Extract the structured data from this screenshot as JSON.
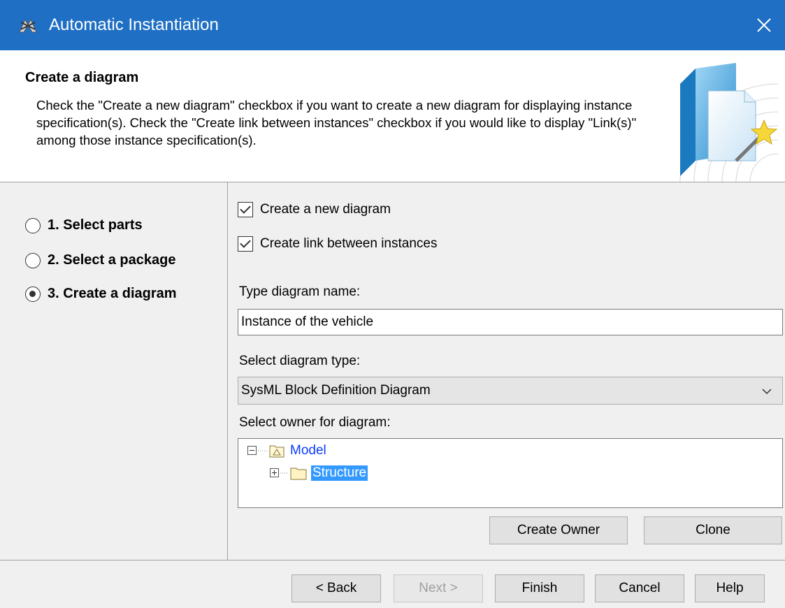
{
  "window": {
    "title": "Automatic Instantiation",
    "close_glyph": "✕",
    "app_icon": "magicdraw-icon"
  },
  "header": {
    "title": "Create a diagram",
    "description": "Check the \"Create a new diagram\" checkbox if you want to create a new diagram for displaying instance specification(s). Check the \"Create link between instances\" checkbox if you would like to display \"Link(s)\" among those instance specification(s).",
    "art_icon": "wizard-folder-icon"
  },
  "steps": [
    {
      "label": "1. Select parts",
      "selected": false
    },
    {
      "label": "2. Select a package",
      "selected": false
    },
    {
      "label": "3. Create a diagram",
      "selected": true
    }
  ],
  "options": {
    "create_new_diagram": {
      "label": "Create a new diagram",
      "checked": true
    },
    "create_link": {
      "label": "Create link between instances",
      "checked": true
    }
  },
  "diagram_name": {
    "label": "Type diagram name:",
    "value": "Instance of the vehicle"
  },
  "diagram_type": {
    "label": "Select diagram type:",
    "value": "SysML Block Definition Diagram"
  },
  "owner": {
    "label": "Select owner for diagram:",
    "tree": [
      {
        "label": "Model",
        "expanded": true,
        "selected": false
      },
      {
        "label": "Structure",
        "expanded": false,
        "selected": true
      }
    ],
    "create_owner_label": "Create Owner",
    "clone_label": "Clone"
  },
  "footer": {
    "back_label": "< Back",
    "next_label": "Next >",
    "finish_label": "Finish",
    "cancel_label": "Cancel",
    "help_label": "Help"
  },
  "colors": {
    "titlebar": "#1f6fc5",
    "link": "#0a3cff",
    "selection": "#3399ff"
  }
}
